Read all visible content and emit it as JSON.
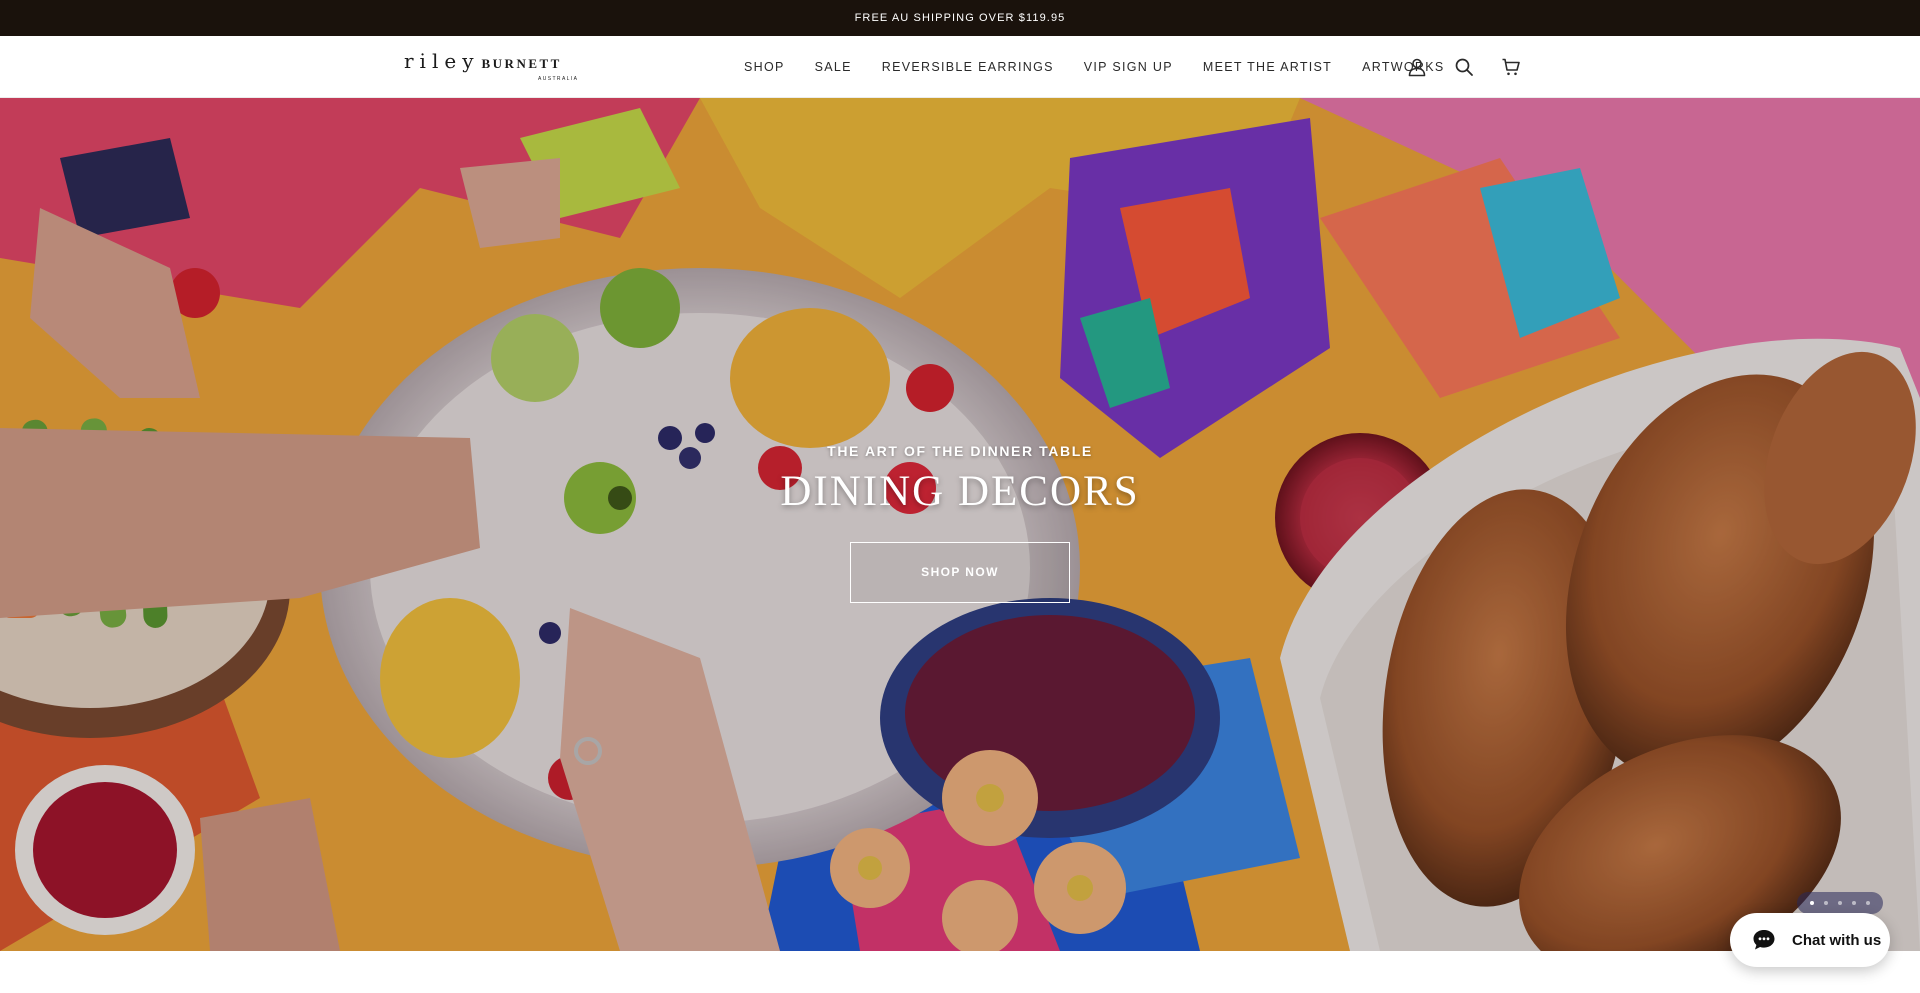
{
  "announcement": {
    "text": "FREE AU SHIPPING OVER $119.95"
  },
  "header": {
    "logo": {
      "main_light": "riley",
      "main_bold": "BURNETT",
      "sub": "AUSTRALIA"
    },
    "nav": [
      {
        "label": "SHOP"
      },
      {
        "label": "SALE"
      },
      {
        "label": "REVERSIBLE EARRINGS"
      },
      {
        "label": "VIP SIGN UP"
      },
      {
        "label": "MEET THE ARTIST"
      },
      {
        "label": "ARTWORKS"
      }
    ],
    "icons": [
      "account-icon",
      "search-icon",
      "cart-icon"
    ]
  },
  "hero": {
    "kicker": "THE ART OF THE DINNER TABLE",
    "title": "DINING DECORS",
    "button_label": "SHOP NOW",
    "slides_count": 5,
    "active_slide": 1
  },
  "chat": {
    "label": "Chat with us"
  },
  "colors": {
    "announcement_bg": "#1a120c",
    "header_bg": "#ffffff",
    "text_dark": "#2a2a2a"
  }
}
